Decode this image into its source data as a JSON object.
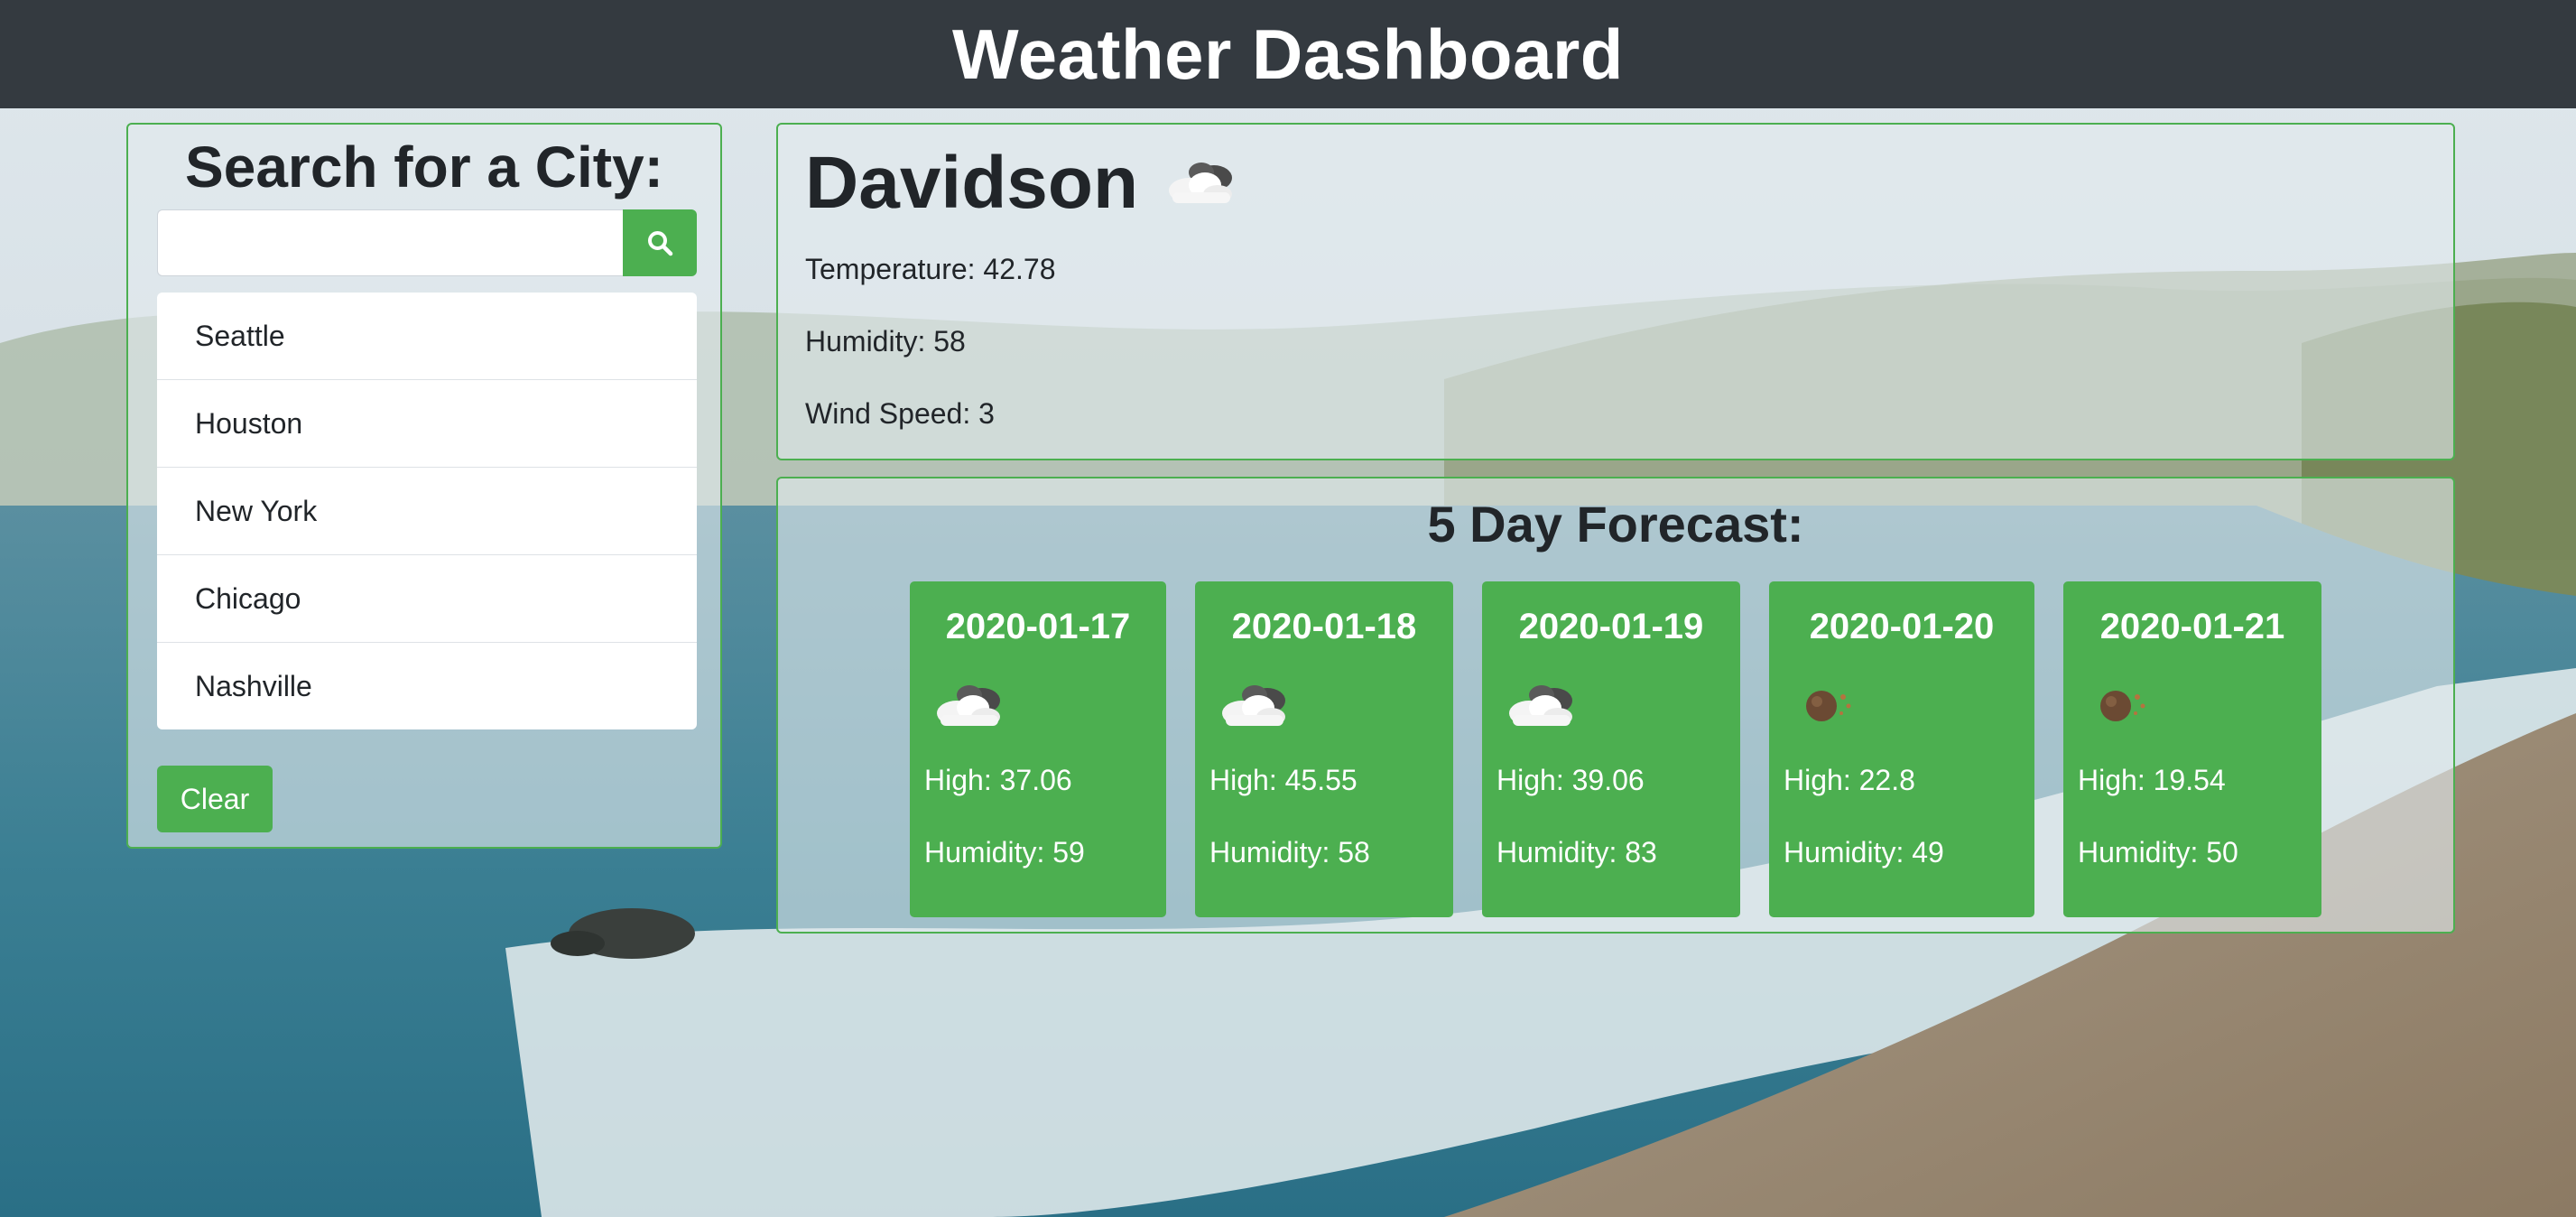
{
  "header": {
    "title": "Weather Dashboard"
  },
  "search": {
    "title": "Search for a City:",
    "input_value": "",
    "input_placeholder": "",
    "button_icon": "search-icon",
    "history": [
      "Seattle",
      "Houston",
      "New York",
      "Chicago",
      "Nashville"
    ],
    "clear_label": "Clear"
  },
  "current": {
    "city": "Davidson",
    "icon": "cloudy-icon",
    "temperature": "Temperature: 42.78",
    "humidity": "Humidity: 58",
    "wind": "Wind Speed: 3"
  },
  "forecast": {
    "title": "5 Day Forecast:",
    "days": [
      {
        "date": "2020-01-17",
        "icon": "cloudy-icon",
        "high": "High: 37.06",
        "humidity": "Humidity: 59"
      },
      {
        "date": "2020-01-18",
        "icon": "cloudy-icon",
        "high": "High: 45.55",
        "humidity": "Humidity: 58"
      },
      {
        "date": "2020-01-19",
        "icon": "cloudy-icon",
        "high": "High: 39.06",
        "humidity": "Humidity: 83"
      },
      {
        "date": "2020-01-20",
        "icon": "meteor-icon",
        "high": "High: 22.8",
        "humidity": "Humidity: 49"
      },
      {
        "date": "2020-01-21",
        "icon": "meteor-icon",
        "high": "High: 19.54",
        "humidity": "Humidity: 50"
      }
    ]
  },
  "colors": {
    "header_bg": "#343a40",
    "accent_green": "#4caf50",
    "text_dark": "#212529"
  }
}
